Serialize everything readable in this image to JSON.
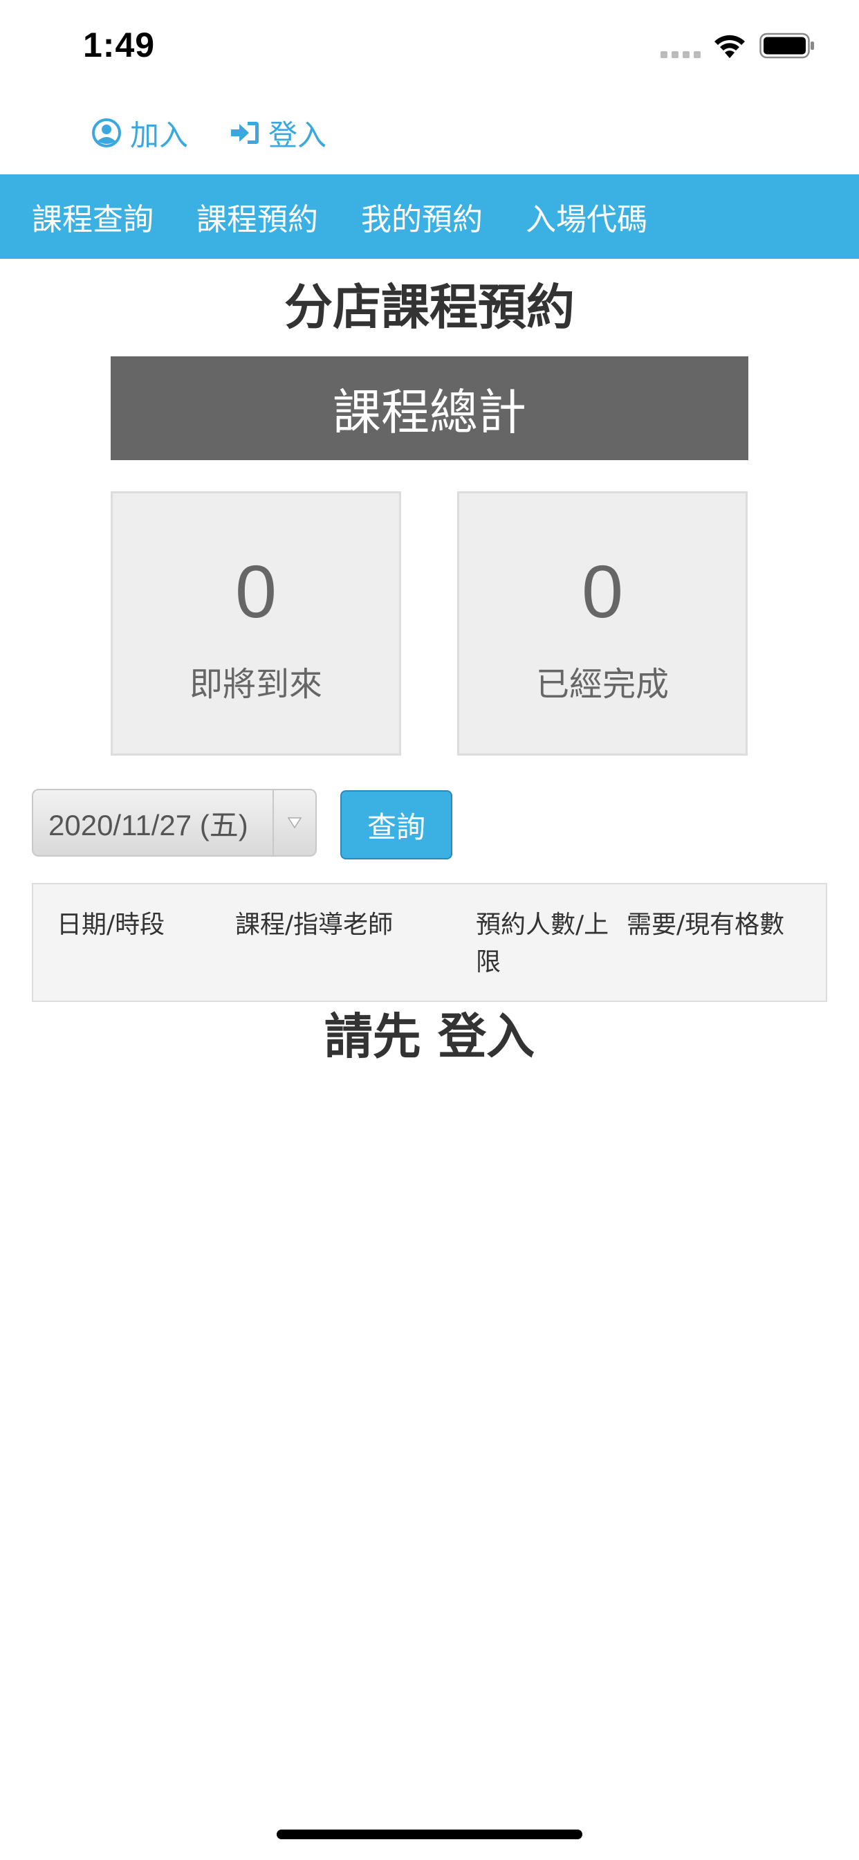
{
  "status_bar": {
    "time": "1:49"
  },
  "account": {
    "join_label": "加入",
    "login_label": "登入"
  },
  "nav": {
    "items": [
      {
        "label": "課程查詢"
      },
      {
        "label": "課程預約"
      },
      {
        "label": "我的預約"
      },
      {
        "label": "入場代碼"
      }
    ]
  },
  "page": {
    "title": "分店課程預約"
  },
  "summary": {
    "header": "課程總計",
    "upcoming": {
      "value": "0",
      "label": "即將到來"
    },
    "completed": {
      "value": "0",
      "label": "已經完成"
    }
  },
  "filter": {
    "date_value": "2020/11/27 (五)",
    "query_label": "查詢"
  },
  "table": {
    "columns": [
      "日期/時段",
      "課程/指導老師",
      "預約人數/上限",
      "需要/現有格數"
    ]
  },
  "login_prompt": "請先 登入",
  "colors": {
    "accent": "#3bb0e3",
    "link": "#3aa8df",
    "summary_header_bg": "#666666",
    "card_bg": "#eeeeee"
  }
}
